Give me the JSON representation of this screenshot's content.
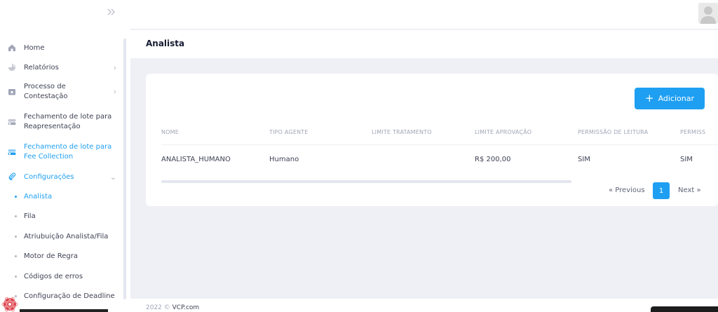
{
  "header": {
    "page_title": "Analista"
  },
  "sidebar": {
    "items": [
      {
        "label": "Home",
        "icon": "home-icon"
      },
      {
        "label": "Relatórios",
        "icon": "pie-chart-icon",
        "has_chevron": true
      },
      {
        "label": "Processo de Contestação",
        "icon": "folder-icon",
        "has_chevron": true
      },
      {
        "label": "Fechamento de lote para Reapresentação",
        "icon": "toggle-icon"
      },
      {
        "label": "Fechamento de lote para Fee Collection",
        "icon": "toggle-icon",
        "active": true
      },
      {
        "label": "Configurações",
        "icon": "paperclip-icon",
        "expanded": true,
        "active": true
      }
    ],
    "subitems": [
      {
        "label": "Analista",
        "active": true
      },
      {
        "label": "Fila"
      },
      {
        "label": "Atriubuição Analista/Fila"
      },
      {
        "label": "Motor de Regra"
      },
      {
        "label": "Códigos de erros"
      },
      {
        "label": "Configuração de Deadline"
      }
    ]
  },
  "toolbar": {
    "add_label": "Adicionar"
  },
  "table": {
    "columns": [
      "NOME",
      "TIPO AGENTE",
      "LIMITE TRATAMENTO",
      "LIMITE APROVAÇÃO",
      "PERMISSÃO DE LEITURA",
      "PERMISS"
    ],
    "rows": [
      [
        "ANALISTA_HUMANO",
        "Humano",
        "",
        "R$ 200,00",
        "SIM",
        "SIM"
      ]
    ]
  },
  "pagination": {
    "previous": "« Previous",
    "current_page": "1",
    "next": "Next »"
  },
  "footer": {
    "year": "2022 ©",
    "link": "VCP.com"
  },
  "colors": {
    "accent": "#1e9ff2",
    "background": "#eef0f5",
    "text": "#3f4254",
    "muted": "#a1a5b7"
  }
}
